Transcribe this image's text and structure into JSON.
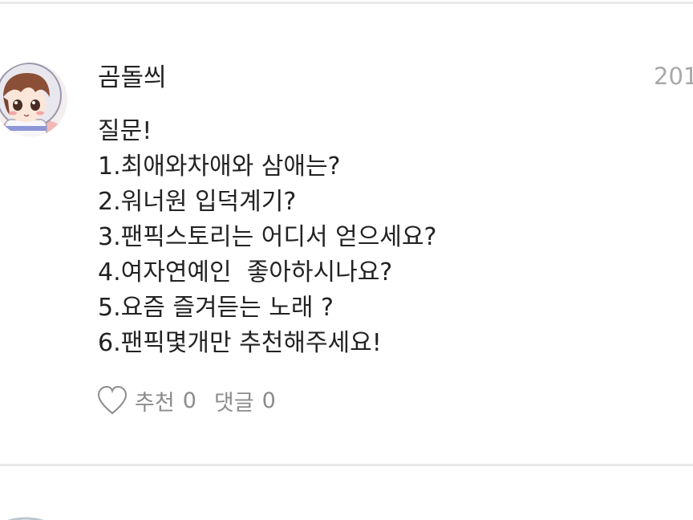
{
  "dividers": [
    "top",
    "bottom"
  ],
  "post": {
    "author": "곰돌씌",
    "timestamp": "201",
    "avatar_icon": "chibi-character-avatar",
    "body_lines": [
      "질문!",
      "1.최애와차애와 삼애는?",
      "2.워너원 입덕계기?",
      "3.팬픽스토리는 어디서 얻으세요?",
      "4.여자연예인  좋아하시나요?",
      "5.요즘 즐겨듣는 노래 ?",
      "6.팬픽몇개만 추천해주세요!"
    ],
    "actions": {
      "like_icon": "heart-outline-icon",
      "like_label": "추천",
      "like_count": "0",
      "comment_label": "댓글",
      "comment_count": "0"
    }
  },
  "colors": {
    "text": "#222222",
    "muted": "#8c8c8c",
    "timestamp": "#a9a9a9",
    "divider": "#e8e8e8",
    "background": "#ffffff"
  }
}
